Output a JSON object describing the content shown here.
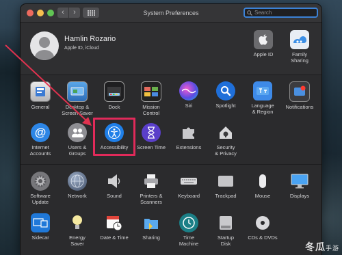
{
  "window": {
    "title": "System Preferences"
  },
  "search": {
    "placeholder": "Search"
  },
  "user": {
    "name": "Hamlin Rozario",
    "subtitle": "Apple ID, iCloud"
  },
  "top_right": [
    {
      "label": "Apple ID",
      "icon": "apple-icon"
    },
    {
      "label": "Family\nSharing",
      "icon": "family-sharing-icon"
    }
  ],
  "row1": [
    {
      "label": "General",
      "icon": "general-icon"
    },
    {
      "label": "Desktop &\nScreen Saver",
      "icon": "desktop-icon"
    },
    {
      "label": "Dock",
      "icon": "dock-icon"
    },
    {
      "label": "Mission\nControl",
      "icon": "mission-control-icon"
    },
    {
      "label": "Siri",
      "icon": "siri-icon"
    },
    {
      "label": "Spotlight",
      "icon": "spotlight-icon"
    },
    {
      "label": "Language\n& Region",
      "icon": "language-icon"
    },
    {
      "label": "Notifications",
      "icon": "notifications-icon"
    }
  ],
  "row2": [
    {
      "label": "Internet\nAccounts",
      "icon": "at-icon"
    },
    {
      "label": "Users &\nGroups",
      "icon": "users-icon"
    },
    {
      "label": "Accessibility",
      "icon": "accessibility-icon"
    },
    {
      "label": "Screen Time",
      "icon": "hourglass-icon"
    },
    {
      "label": "Extensions",
      "icon": "puzzle-icon"
    },
    {
      "label": "Security\n& Privacy",
      "icon": "house-icon"
    }
  ],
  "row3": [
    {
      "label": "Software\nUpdate",
      "icon": "gear-icon"
    },
    {
      "label": "Network",
      "icon": "globe-icon"
    },
    {
      "label": "Sound",
      "icon": "speaker-icon"
    },
    {
      "label": "Printers &\nScanners",
      "icon": "printer-icon"
    },
    {
      "label": "Keyboard",
      "icon": "keyboard-icon"
    },
    {
      "label": "Trackpad",
      "icon": "trackpad-icon"
    },
    {
      "label": "Mouse",
      "icon": "mouse-icon"
    },
    {
      "label": "Displays",
      "icon": "display-icon"
    }
  ],
  "row4": [
    {
      "label": "Sidecar",
      "icon": "sidecar-icon"
    },
    {
      "label": "Energy\nSaver",
      "icon": "bulb-icon"
    },
    {
      "label": "Date & Time",
      "icon": "calendar-icon"
    },
    {
      "label": "Sharing",
      "icon": "sharing-icon"
    },
    {
      "label": "Time\nMachine",
      "icon": "clock-icon"
    },
    {
      "label": "Startup\nDisk",
      "icon": "disk-icon"
    },
    {
      "label": "CDs & DVDs",
      "icon": "cd-icon"
    }
  ],
  "watermark": {
    "main": "冬瓜",
    "sub": "手游"
  },
  "colors": {
    "highlight": "#e12a5a",
    "accent": "#3c82d6"
  }
}
